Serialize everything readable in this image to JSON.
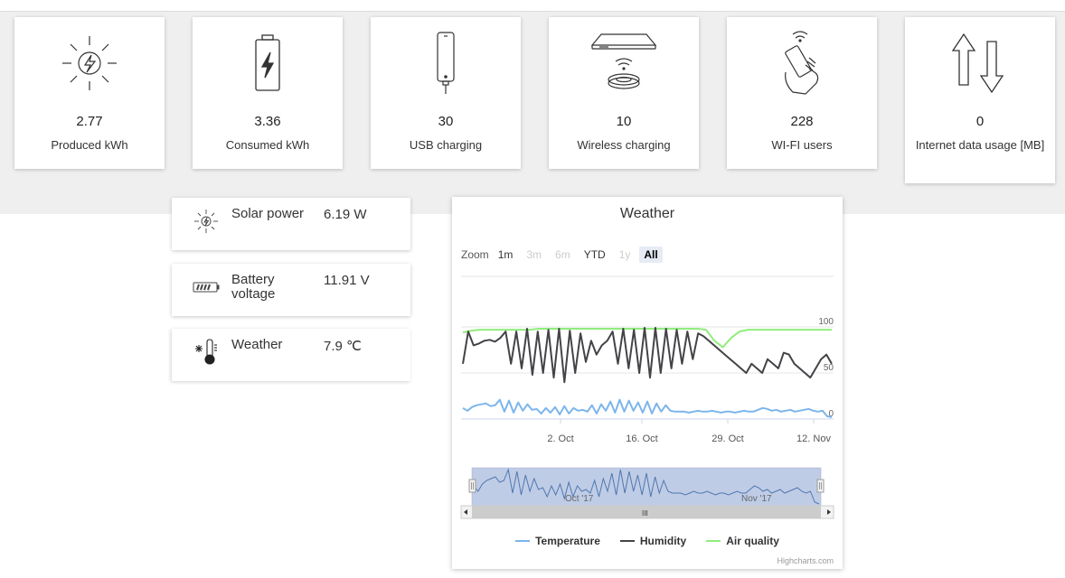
{
  "stats": [
    {
      "value": "2.77",
      "label": "Produced kWh",
      "icon": "solar-bolt-icon"
    },
    {
      "value": "3.36",
      "label": "Consumed kWh",
      "icon": "battery-icon"
    },
    {
      "value": "30",
      "label": "USB charging",
      "icon": "usb-phone-icon"
    },
    {
      "value": "10",
      "label": "Wireless charging",
      "icon": "wireless-charger-icon"
    },
    {
      "value": "228",
      "label": "WI-FI users",
      "icon": "wifi-hand-phone-icon"
    },
    {
      "value": "0",
      "label": "Internet data usage [MB]",
      "icon": "up-down-arrows-icon"
    }
  ],
  "readings": [
    {
      "label": "Solar power",
      "value": "6.19 W",
      "icon": "solar-icon"
    },
    {
      "label": "Battery voltage",
      "value": "11.91 V",
      "icon": "battery-level-icon"
    },
    {
      "label": "Weather",
      "value": "7.9 ℃",
      "icon": "weather-thermometer-icon"
    }
  ],
  "chart": {
    "title": "Weather",
    "zoom_label": "Zoom",
    "zoom_buttons": [
      {
        "label": "1m",
        "state": "normal"
      },
      {
        "label": "3m",
        "state": "disabled"
      },
      {
        "label": "6m",
        "state": "disabled"
      },
      {
        "label": "YTD",
        "state": "normal"
      },
      {
        "label": "1y",
        "state": "disabled"
      },
      {
        "label": "All",
        "state": "selected"
      }
    ],
    "navigator_labels": [
      "Oct '17",
      "Nov '17"
    ],
    "scrollbar_grip": "III",
    "credits": "Highcharts.com"
  },
  "chart_data": {
    "type": "line",
    "title": "Weather",
    "x_ticks": [
      "2. Oct",
      "16. Oct",
      "29. Oct",
      "12. Nov"
    ],
    "y_ticks": [
      0,
      50,
      100
    ],
    "ylim": [
      0,
      100
    ],
    "legend_position": "bottom",
    "series": [
      {
        "name": "Temperature",
        "color": "#7cb5ec",
        "values": [
          12,
          9,
          13,
          15,
          16,
          17,
          14,
          15,
          21,
          8,
          20,
          7,
          18,
          9,
          16,
          10,
          11,
          6,
          12,
          7,
          13,
          5,
          14,
          6,
          12,
          9,
          10,
          8,
          15,
          6,
          16,
          9,
          19,
          7,
          21,
          8,
          20,
          9,
          18,
          7,
          19,
          6,
          17,
          8,
          15,
          9,
          8,
          8,
          8,
          7,
          8,
          9,
          8,
          8,
          9,
          8,
          7,
          8,
          8,
          7,
          8,
          9,
          8,
          8,
          10,
          12,
          11,
          9,
          10,
          8,
          9,
          10,
          8,
          9,
          10,
          11,
          9,
          8,
          9,
          3,
          2
        ]
      },
      {
        "name": "Humidity",
        "color": "#434348",
        "values": [
          60,
          95,
          80,
          82,
          85,
          86,
          84,
          88,
          95,
          60,
          95,
          55,
          98,
          48,
          95,
          50,
          97,
          45,
          98,
          40,
          96,
          50,
          93,
          62,
          85,
          70,
          80,
          85,
          95,
          60,
          98,
          55,
          97,
          50,
          99,
          45,
          99,
          50,
          98,
          55,
          97,
          60,
          95,
          65,
          93,
          90,
          85,
          80,
          75,
          70,
          65,
          60,
          55,
          50,
          60,
          55,
          50,
          65,
          60,
          55,
          72,
          70,
          60,
          55,
          50,
          45,
          55,
          65,
          70,
          60
        ]
      },
      {
        "name": "Air quality",
        "color": "#90ed7d",
        "values": [
          94,
          96,
          97,
          97,
          97,
          97,
          97,
          97,
          97,
          98,
          98,
          98,
          98,
          98,
          98,
          98,
          98,
          98,
          98,
          98,
          98,
          98,
          98,
          98,
          98,
          98,
          98,
          98,
          98,
          97,
          85,
          78,
          88,
          95,
          97,
          97,
          97,
          97,
          97,
          97,
          97,
          97,
          97,
          97,
          97
        ]
      }
    ]
  }
}
